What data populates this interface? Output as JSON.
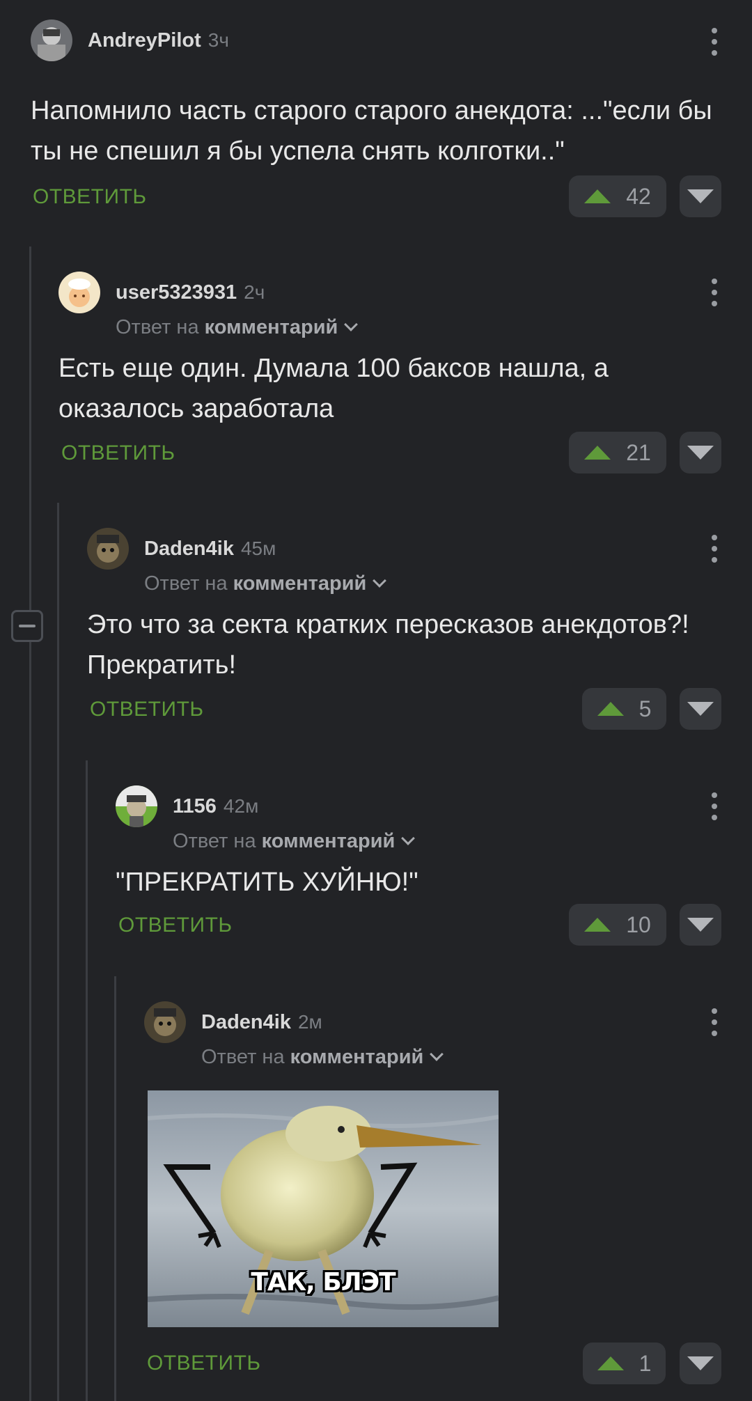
{
  "colors": {
    "background": "#222326",
    "accent_green": "#5f9a3a",
    "vote_bg": "#35373b",
    "thread_line": "#3b3d42"
  },
  "thread_collapse_icon": "minus-square-icon",
  "comments": [
    {
      "author": "AndreyPilot",
      "time": "3ч",
      "reply_prefix": "",
      "reply_target": "",
      "text": "Напомнило часть старого старого анекдота: ...\"если бы ты не спешил я бы успела снять колготки..\"",
      "reply_label": "ОТВЕТИТЬ",
      "rating": "42"
    },
    {
      "author": "user5323931",
      "time": "2ч",
      "reply_prefix": "Ответ на",
      "reply_target": "комментарий",
      "text": "Есть еще один. Думала 100 баксов нашла, а оказалось заработала",
      "reply_label": "ОТВЕТИТЬ",
      "rating": "21"
    },
    {
      "author": "Daden4ik",
      "time": "45м",
      "reply_prefix": "Ответ на",
      "reply_target": "комментарий",
      "text": "Это что за секта кратких пересказов анекдотов?! Прекратить!",
      "reply_label": "ОТВЕТИТЬ",
      "rating": "5"
    },
    {
      "author": "1156",
      "time": "42м",
      "reply_prefix": "Ответ на",
      "reply_target": "комментарий",
      "text": "\"ПРЕКРАТИТЬ ХУЙНЮ!\"",
      "reply_label": "ОТВЕТИТЬ",
      "rating": "10"
    },
    {
      "author": "Daden4ik",
      "time": "2м",
      "reply_prefix": "Ответ на",
      "reply_target": "комментарий",
      "image_caption": "ТАК, БЛЭТ",
      "reply_label": "ОТВЕТИТЬ",
      "rating": "1"
    }
  ]
}
